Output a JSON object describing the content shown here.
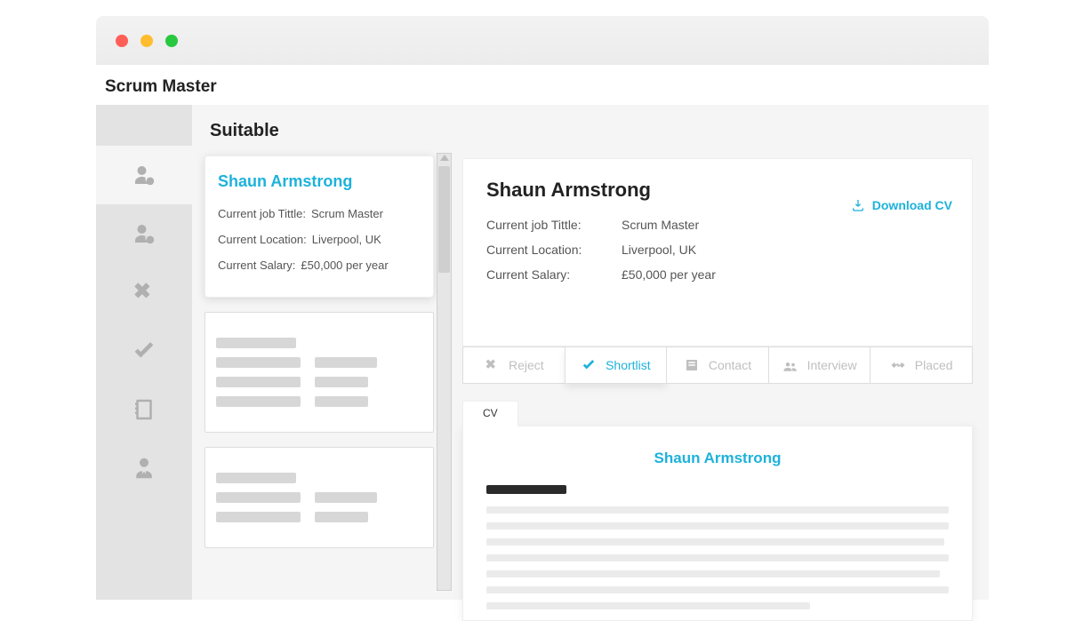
{
  "page": {
    "title": "Scrum Master"
  },
  "list": {
    "section_title": "Suitable",
    "card": {
      "name": "Shaun Armstrong",
      "job_title_label": "Current job Tittle:",
      "job_title_value": "Scrum Master",
      "location_label": "Current Location:",
      "location_value": "Liverpool, UK",
      "salary_label": "Current Salary:",
      "salary_value": "£50,000 per year"
    }
  },
  "detail": {
    "name": "Shaun Armstrong",
    "download_label": "Download CV",
    "rows": {
      "job_title_label": "Current job Tittle:",
      "job_title_value": "Scrum Master",
      "location_label": "Current Location:",
      "location_value": "Liverpool, UK",
      "salary_label": "Current Salary:",
      "salary_value": "£50,000 per year"
    },
    "actions": {
      "reject": "Reject",
      "shortlist": "Shortlist",
      "contact": "Contact",
      "interview": "Interview",
      "placed": "Placed"
    }
  },
  "cv": {
    "tab_label": "CV",
    "heading": "Shaun Armstrong"
  }
}
